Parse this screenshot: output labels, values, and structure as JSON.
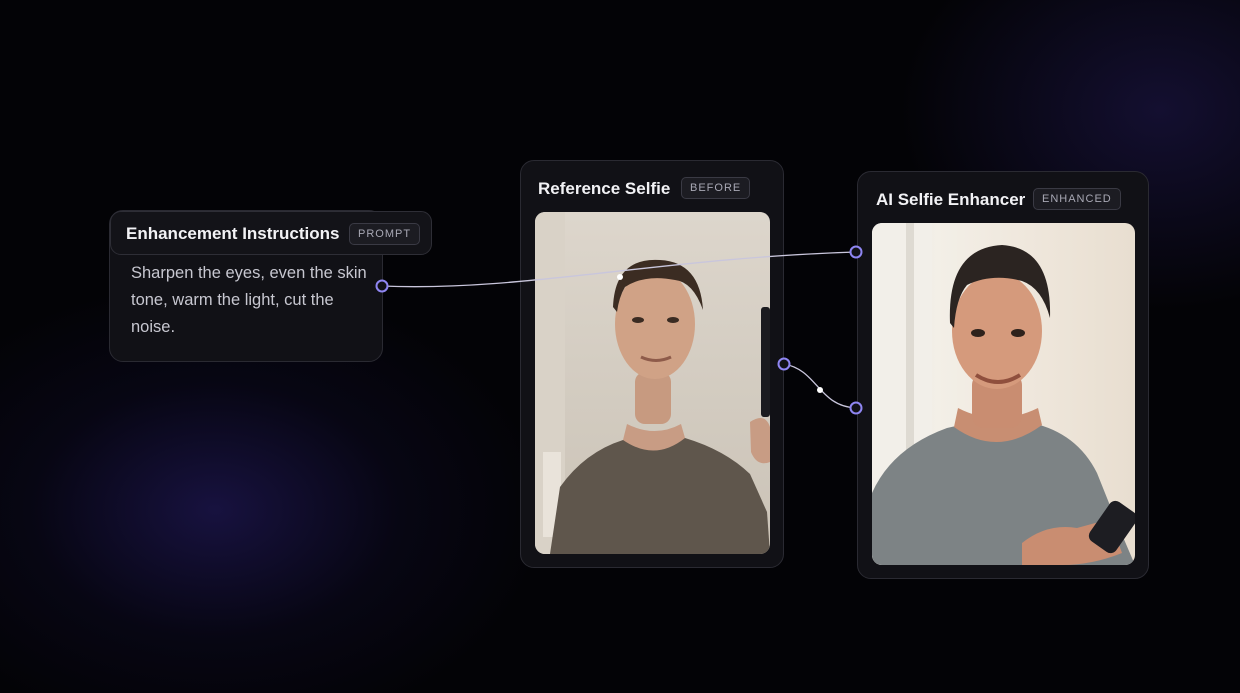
{
  "nodes": {
    "prompt": {
      "title": "Enhancement Instructions",
      "badge": "PROMPT",
      "text": "Sharpen the eyes, even the skin tone, warm the light, cut the noise."
    },
    "before": {
      "title": "Reference Selfie",
      "badge": "BEFORE"
    },
    "enhanced": {
      "title": "AI Selfie Enhancer",
      "badge": "ENHANCED"
    }
  },
  "colors": {
    "port": "#8f86f2",
    "wire": "#c9c6dc",
    "card_bg": "#111116"
  },
  "icons": [
    "port-icon"
  ]
}
